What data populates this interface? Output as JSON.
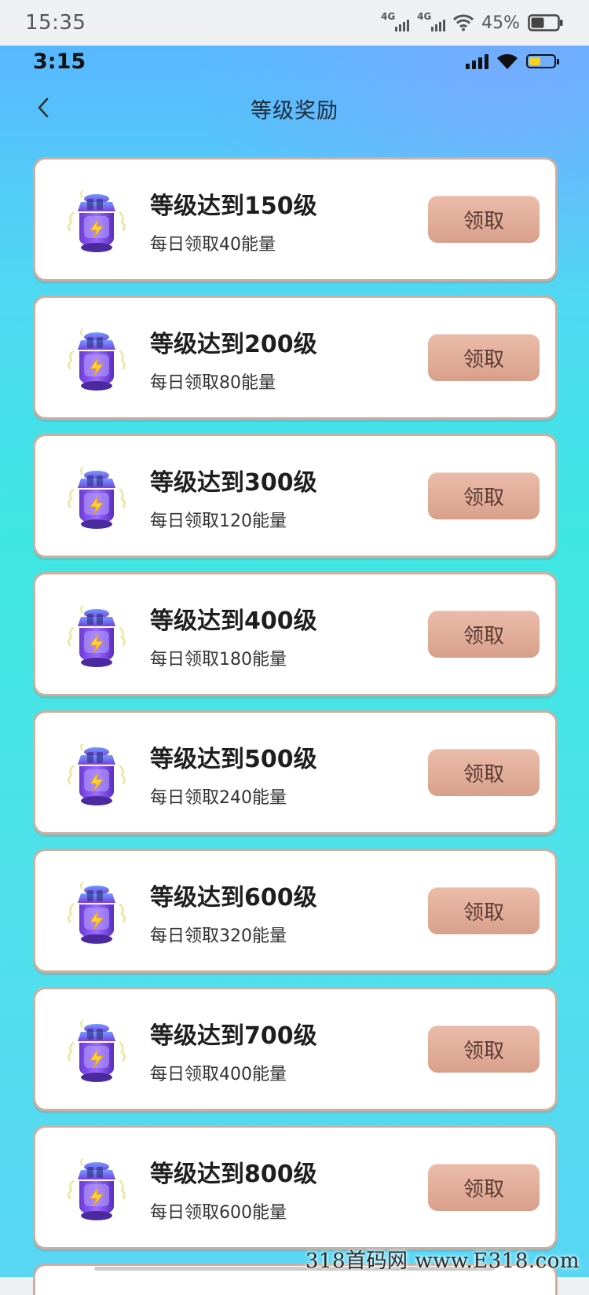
{
  "outer_status": {
    "time": "15:35",
    "network1": "4G",
    "network2": "4G",
    "battery": "45%"
  },
  "inner_status": {
    "time": "3:15"
  },
  "header": {
    "title": "等级奖励"
  },
  "rewards": [
    {
      "level": "等级达到150级",
      "desc": "每日领取40能量",
      "button": "领取"
    },
    {
      "level": "等级达到200级",
      "desc": "每日领取80能量",
      "button": "领取"
    },
    {
      "level": "等级达到300级",
      "desc": "每日领取120能量",
      "button": "领取"
    },
    {
      "level": "等级达到400级",
      "desc": "每日领取180能量",
      "button": "领取"
    },
    {
      "level": "等级达到500级",
      "desc": "每日领取240能量",
      "button": "领取"
    },
    {
      "level": "等级达到600级",
      "desc": "每日领取320能量",
      "button": "领取"
    },
    {
      "level": "等级达到700级",
      "desc": "每日领取400能量",
      "button": "领取"
    },
    {
      "level": "等级达到800级",
      "desc": "每日领取600能量",
      "button": "领取"
    }
  ],
  "watermark": "318首码网 www.E318.com",
  "colors": {
    "button": "#dda894",
    "card_border": "#cfae9f",
    "battery_fill": "#f6d21b"
  }
}
